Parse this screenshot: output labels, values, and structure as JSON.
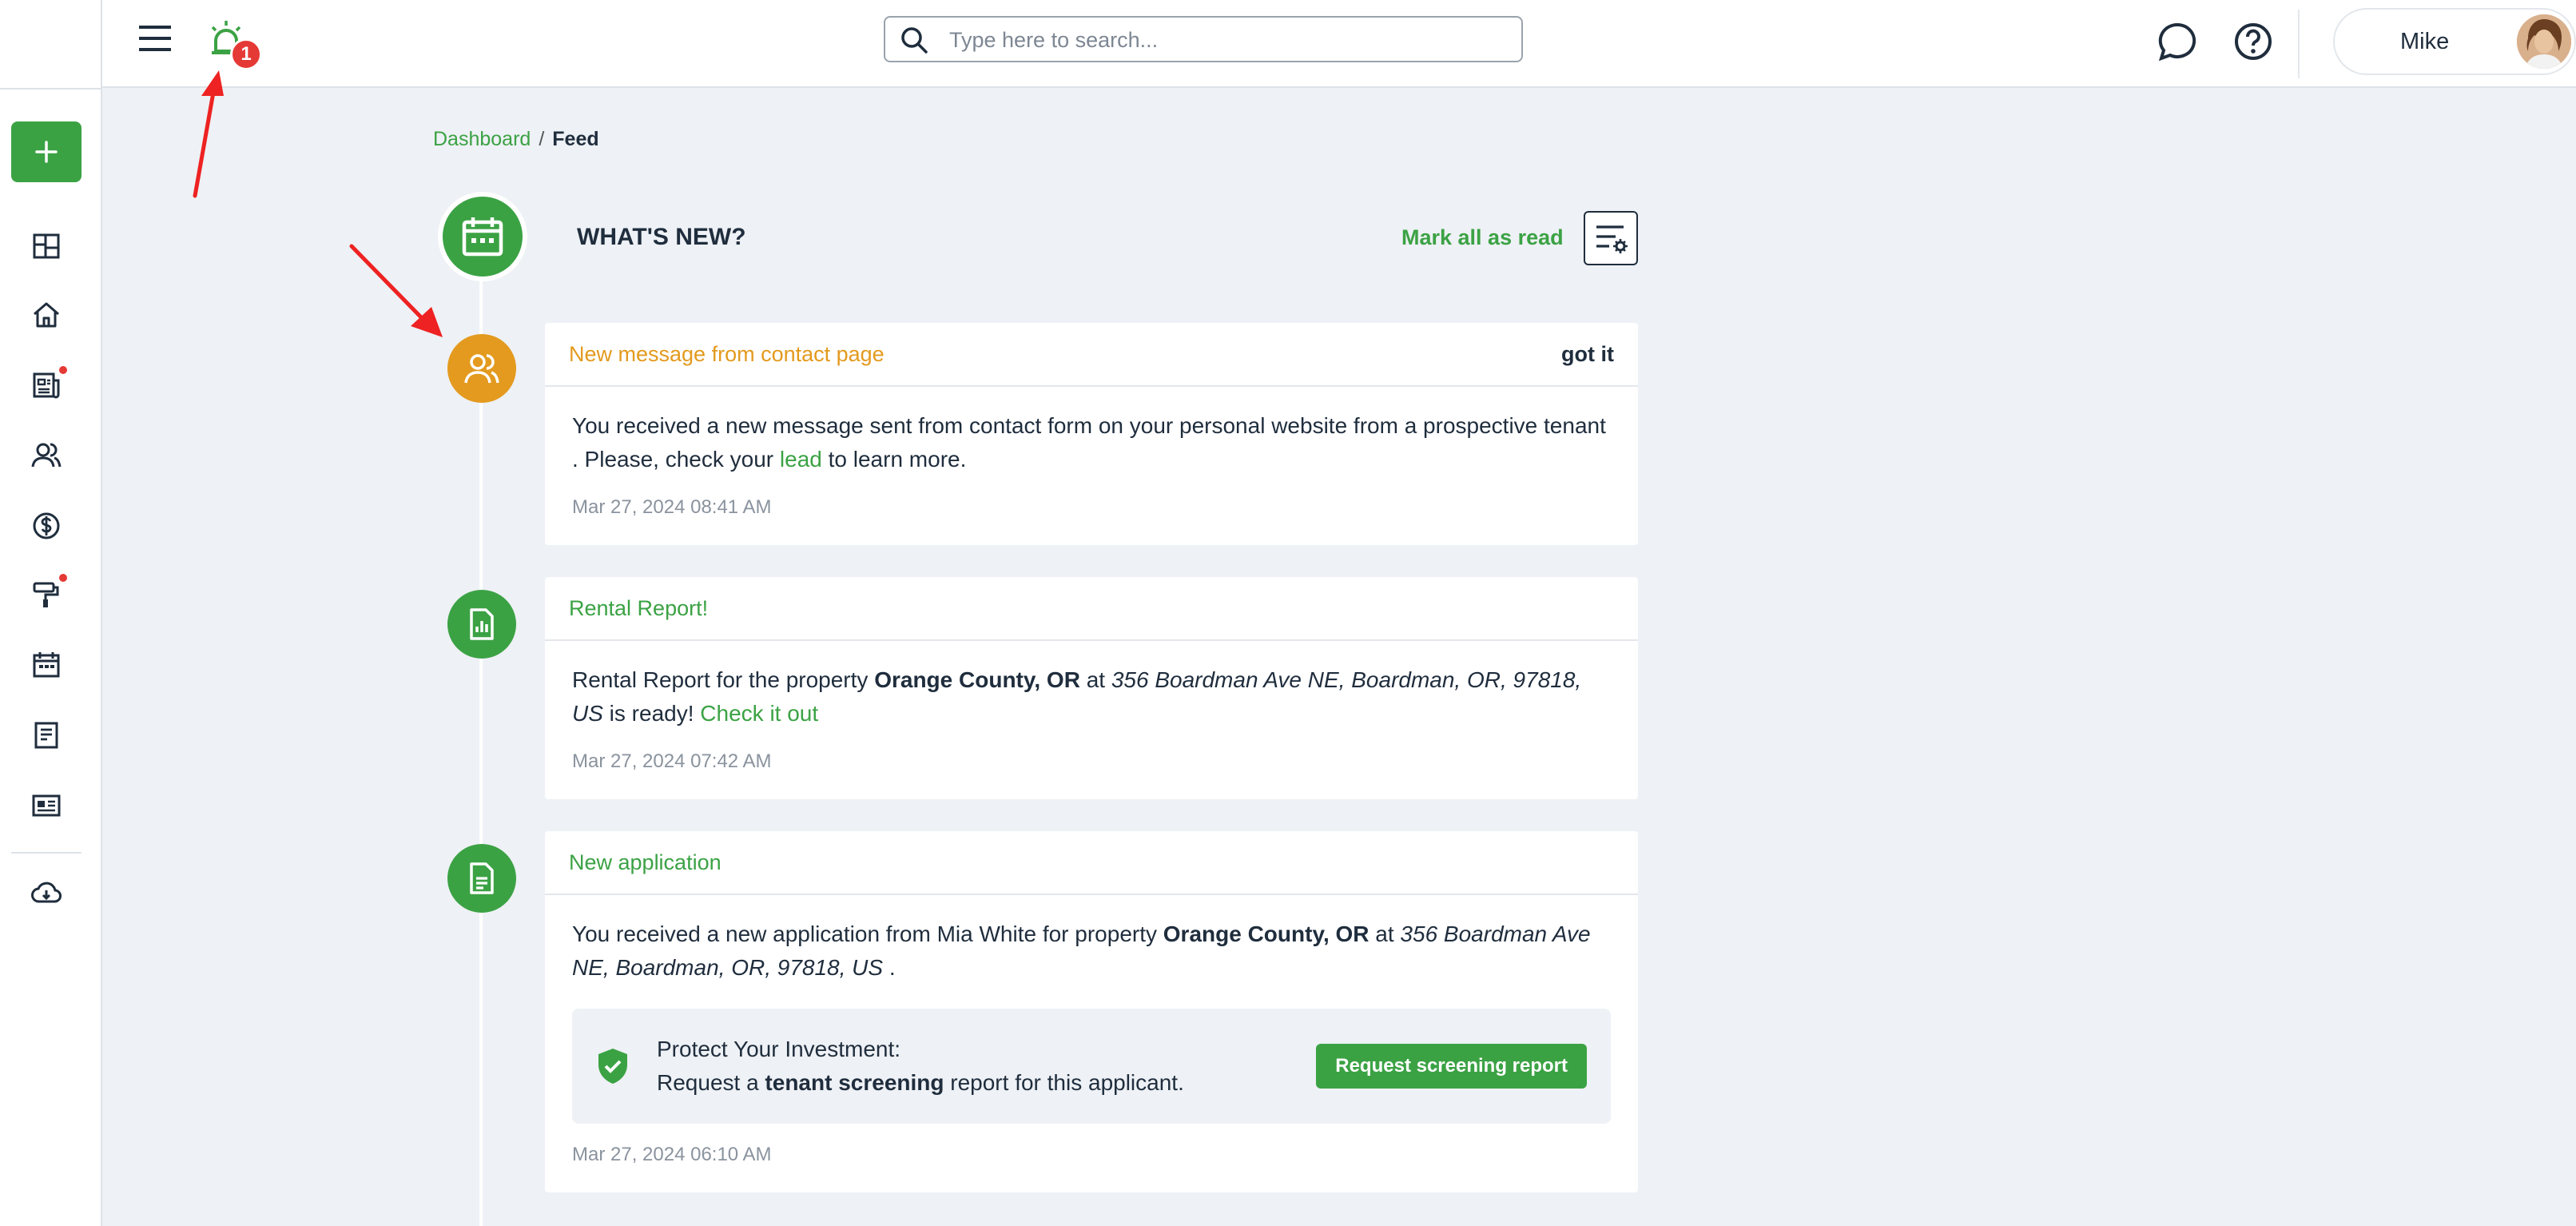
{
  "topbar": {
    "notification_count": "1",
    "search_placeholder": "Type here to search...",
    "user_name": "Mike"
  },
  "breadcrumb": {
    "parent": "Dashboard",
    "separator": "/",
    "current": "Feed"
  },
  "feed_header": {
    "title": "WHAT'S NEW?",
    "mark_all_label": "Mark all as read"
  },
  "colors": {
    "brand_green": "#3ba244",
    "accent_orange": "#e39a1e",
    "alert_red": "#e53935"
  },
  "feed": [
    {
      "icon": "users-icon",
      "title": "New message from contact page",
      "action": "got it",
      "body_1": "You received a new message sent from contact form on your personal website from a prospective tenant . Please, check your ",
      "body_link": "lead",
      "body_2": " to learn more.",
      "time": "Mar 27, 2024 08:41 AM"
    },
    {
      "icon": "report-icon",
      "title": "Rental Report!",
      "body_1": "Rental Report for the property ",
      "property": "Orange County, OR",
      "at": " at ",
      "address": "356 Boardman Ave NE, Boardman, OR, 97818, US",
      "body_2": " is ready! ",
      "body_link": "Check it out",
      "time": "Mar 27, 2024 07:42 AM"
    },
    {
      "icon": "document-icon",
      "title": "New application",
      "body_1": "You received a new application from Mia White for property ",
      "property": "Orange County, OR",
      "at": " at ",
      "address": "356 Boardman Ave NE, Boardman, OR, 97818, US",
      "body_2": " .",
      "protect_line1": "Protect Your Investment:",
      "protect_pre": "Request a ",
      "protect_bold": "tenant screening",
      "protect_post": " report for this applicant.",
      "button_label": "Request screening report",
      "time": "Mar 27, 2024 06:10 AM"
    }
  ]
}
